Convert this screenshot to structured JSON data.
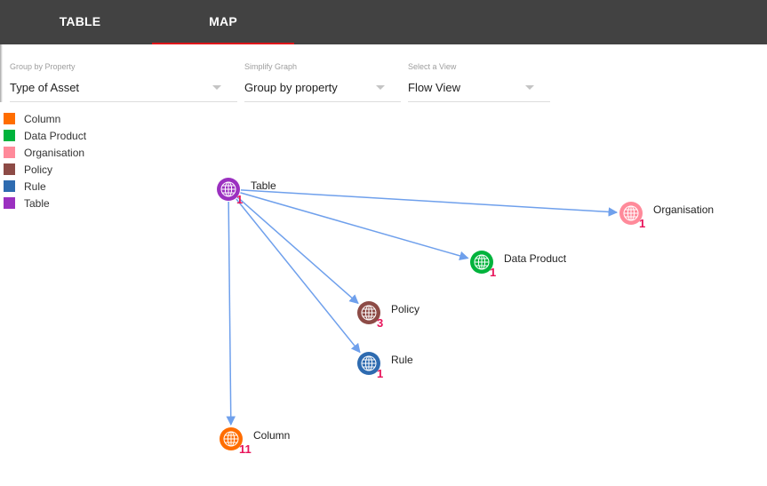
{
  "tabs": [
    {
      "label": "TABLE",
      "active": false
    },
    {
      "label": "MAP",
      "active": true
    }
  ],
  "filters": {
    "group_by": {
      "label": "Group by Property",
      "value": "Type of Asset"
    },
    "simplify": {
      "label": "Simplify Graph",
      "value": "Group by property"
    },
    "view": {
      "label": "Select a View",
      "value": "Flow View"
    }
  },
  "legend": [
    {
      "label": "Column",
      "color": "#ff6d00"
    },
    {
      "label": "Data Product",
      "color": "#00b33c"
    },
    {
      "label": "Organisation",
      "color": "#ff8a9a"
    },
    {
      "label": "Policy",
      "color": "#8d4b46"
    },
    {
      "label": "Rule",
      "color": "#2e6bb0"
    },
    {
      "label": "Table",
      "color": "#9b30c0"
    }
  ],
  "graph": {
    "edge_color": "#6fa0ec",
    "count_color": "#e8145a",
    "nodes": [
      {
        "id": "table",
        "label": "Table",
        "count": "1",
        "color": "#9b30c0",
        "icon": "globe-icon"
      },
      {
        "id": "organisation",
        "label": "Organisation",
        "count": "1",
        "color": "#ff8a9a",
        "icon": "globe-icon"
      },
      {
        "id": "data-product",
        "label": "Data Product",
        "count": "1",
        "color": "#00b33c",
        "icon": "globe-icon"
      },
      {
        "id": "policy",
        "label": "Policy",
        "count": "3",
        "color": "#8d4b46",
        "icon": "globe-icon"
      },
      {
        "id": "rule",
        "label": "Rule",
        "count": "1",
        "color": "#2e6bb0",
        "icon": "globe-icon"
      },
      {
        "id": "column",
        "label": "Column",
        "count": "11",
        "color": "#ff6d00",
        "icon": "globe-icon"
      }
    ],
    "edges": [
      {
        "from": "table",
        "to": "organisation"
      },
      {
        "from": "table",
        "to": "data-product"
      },
      {
        "from": "table",
        "to": "policy"
      },
      {
        "from": "table",
        "to": "rule"
      },
      {
        "from": "table",
        "to": "column"
      }
    ]
  }
}
